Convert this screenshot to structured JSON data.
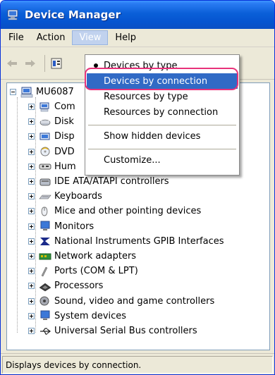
{
  "window": {
    "title": "Device Manager"
  },
  "menubar": {
    "items": [
      "File",
      "Action",
      "View",
      "Help"
    ]
  },
  "tree": {
    "root": "MU6087",
    "rows": [
      {
        "label": "Com",
        "icon": "computer-icon"
      },
      {
        "label": "Disk",
        "icon": "disk-drive-icon"
      },
      {
        "label": "Disp",
        "icon": "display-adapter-icon"
      },
      {
        "label": "DVD",
        "icon": "dvd-drive-icon"
      },
      {
        "label": "Hum",
        "icon": "human-interface-icon"
      },
      {
        "label": "IDE ATA/ATAPI controllers",
        "icon": "ide-controller-icon"
      },
      {
        "label": "Keyboards",
        "icon": "keyboard-icon"
      },
      {
        "label": "Mice and other pointing devices",
        "icon": "mouse-icon"
      },
      {
        "label": "Monitors",
        "icon": "monitor-icon"
      },
      {
        "label": "National Instruments GPIB Interfaces",
        "icon": "gpib-icon"
      },
      {
        "label": "Network adapters",
        "icon": "network-adapter-icon"
      },
      {
        "label": "Ports (COM & LPT)",
        "icon": "port-icon"
      },
      {
        "label": "Processors",
        "icon": "processor-icon"
      },
      {
        "label": "Sound, video and game controllers",
        "icon": "sound-icon"
      },
      {
        "label": "System devices",
        "icon": "system-device-icon"
      },
      {
        "label": "Universal Serial Bus controllers",
        "icon": "usb-icon"
      }
    ]
  },
  "view_menu": {
    "items": [
      "Devices by type",
      "Devices by connection",
      "Resources by type",
      "Resources by connection",
      "Show hidden devices",
      "Customize..."
    ],
    "checked_index": 0,
    "highlighted_index": 1
  },
  "statusbar": {
    "text": "Displays devices by connection."
  },
  "colors": {
    "titlebar": "#0554d0",
    "highlight": "#316ac5",
    "annotation": "#e8327a"
  }
}
